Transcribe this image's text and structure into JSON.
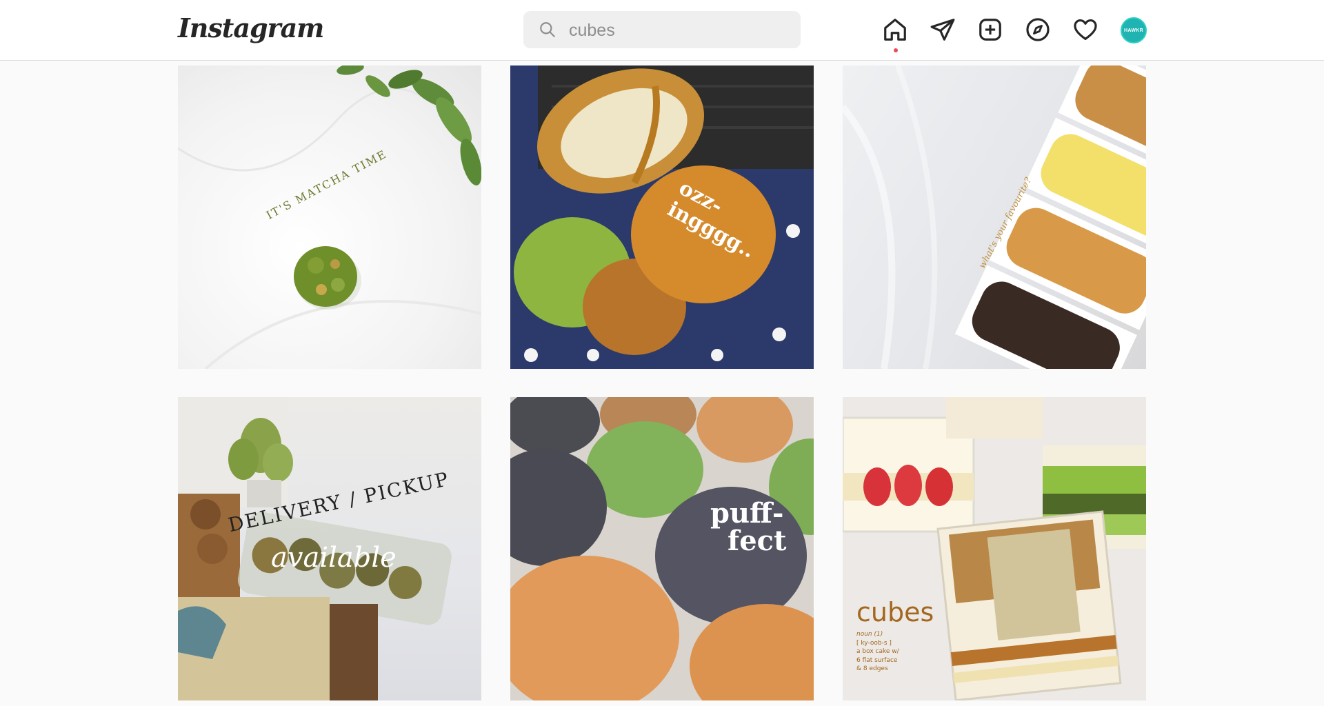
{
  "app": {
    "logo": "Instagram"
  },
  "search": {
    "value": "cubes"
  },
  "nav": {
    "items": [
      {
        "name": "home-icon",
        "active": true
      },
      {
        "name": "direct-messages-icon"
      },
      {
        "name": "new-post-icon"
      },
      {
        "name": "explore-icon"
      },
      {
        "name": "activity-heart-icon"
      },
      {
        "name": "profile-avatar"
      }
    ],
    "avatar_text": "HAWKR",
    "notification_color": "#ed4956"
  },
  "posts": [
    {
      "caption": "IT'S MATCHA TIME"
    },
    {
      "caption": "ozz-ingggg.."
    },
    {
      "caption": "what's your favourite?"
    },
    {
      "caption_line1": "DELIVERY / PICKUP",
      "caption_line2": "available"
    },
    {
      "caption_line1": "puff-",
      "caption_line2": "fect"
    },
    {
      "caption": "cubes",
      "definition": [
        "noun (1)",
        "[ ky-oob-s ]",
        "a box cake w/",
        "6 flat surface",
        "& 8 edges"
      ]
    }
  ]
}
